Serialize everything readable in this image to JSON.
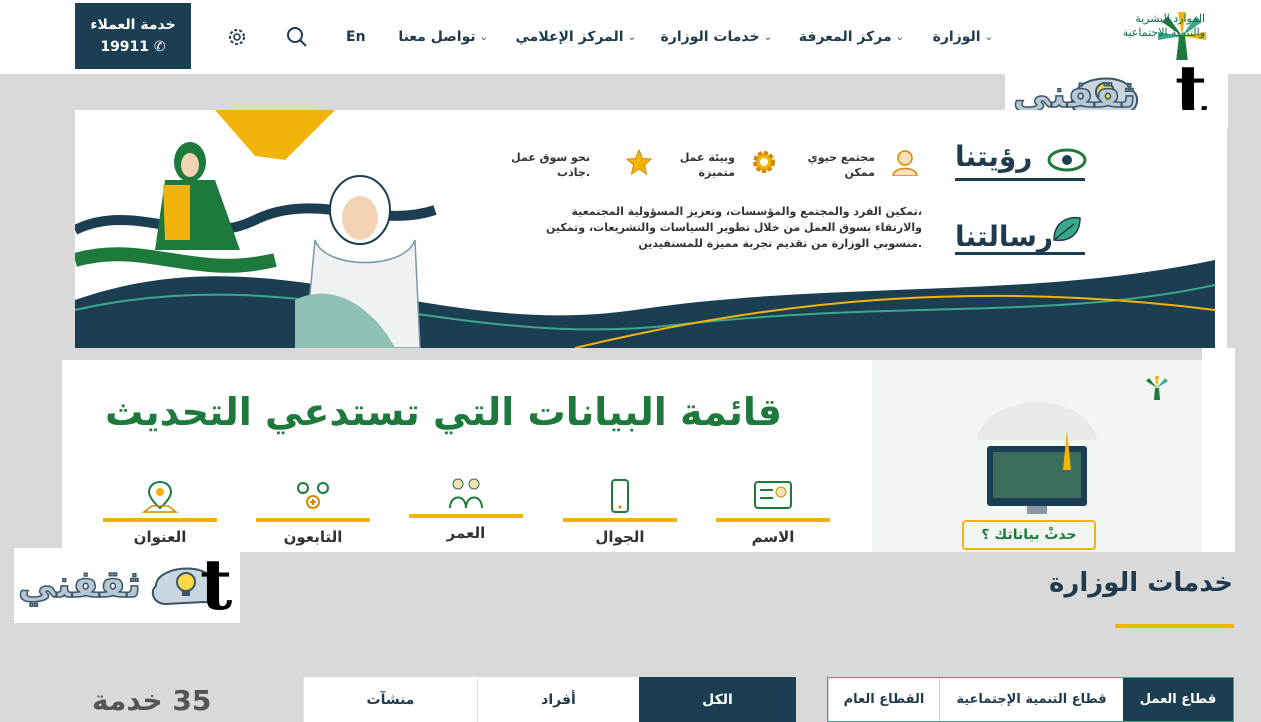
{
  "header": {
    "logo": {
      "line1": "الموارد البشرية",
      "line2": "والتنمية الاجتماعية"
    },
    "nav": [
      {
        "label": "الوزارة"
      },
      {
        "label": "مركز المعرفة"
      },
      {
        "label": "خدمات الوزارة"
      },
      {
        "label": "المركز الإعلامي"
      },
      {
        "label": "تواصل معنا"
      }
    ],
    "lang": "En",
    "customer_service": {
      "label": "خدمة العملاء",
      "number": "19911"
    }
  },
  "watermark": {
    "text": "ثقفني",
    "letter": "t"
  },
  "vision_banner": {
    "vision_title": "رؤيتنا",
    "mission_title": "رسالتنا",
    "vision_items": [
      {
        "line1": "مجتمع حيوي",
        "line2": "ممكن"
      },
      {
        "line1": "وبيئة عمل",
        "line2": "متميزة"
      },
      {
        "line1": "نحو سوق عمل",
        "line2": "جاذب."
      }
    ],
    "mission_lines": [
      "تمكين الفرد والمجتمع والمؤسسات، وتعزيز المسؤولية المجتمعية،",
      "والارتقاء بسوق العمل من خلال تطوير السياسات والتشريعات، وتمكين",
      "منسوبي الوزارة من تقديم تجربة مميزة للمستفيدين."
    ]
  },
  "data_banner": {
    "title": "قائمة البيانات التي تستدعي التحديث",
    "items": [
      "الاسم",
      "الجوال",
      "العمر",
      "التابعون",
      "العنوان"
    ],
    "update_label": "حدثْ بياناتك ؟"
  },
  "services": {
    "title": "خدمات الوزارة",
    "sector_tabs": [
      "قطاع العمل",
      "قطاع التنمية الإجتماعية",
      "القطاع العام"
    ],
    "audience_tabs": [
      "الكل",
      "أفراد",
      "منشآت"
    ],
    "count": "35 خدمة"
  },
  "colors": {
    "primary": "#1c3e52",
    "accent": "#f2b30a",
    "green": "#1d7a3c"
  }
}
